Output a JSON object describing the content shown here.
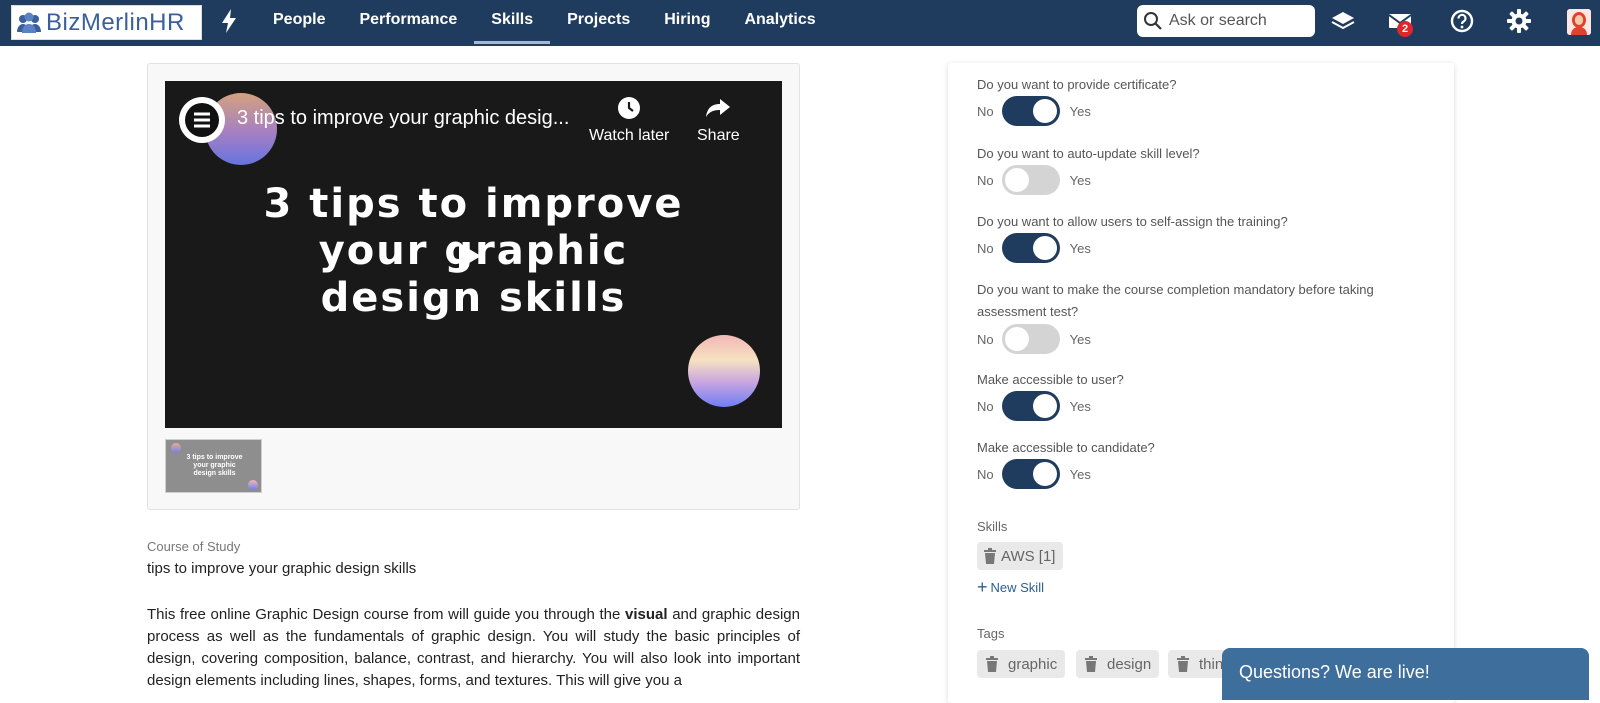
{
  "brand": {
    "name": "BizMerlinHR"
  },
  "nav": {
    "items": [
      {
        "label": "People"
      },
      {
        "label": "Performance"
      },
      {
        "label": "Skills",
        "active": true
      },
      {
        "label": "Projects"
      },
      {
        "label": "Hiring"
      },
      {
        "label": "Analytics"
      }
    ]
  },
  "search": {
    "placeholder": "Ask or search"
  },
  "notifications": {
    "mail_count": "2"
  },
  "colors": {
    "nav_bg": "#1f3c5e",
    "toggle_on": "#1f3c5e",
    "toggle_off": "#d4d4d4",
    "chat_bg": "#3d6e9c",
    "badge": "#e0262b"
  },
  "icons": [
    "bolt-icon",
    "search-icon",
    "layers-icon",
    "mail-icon",
    "help-icon",
    "gear-icon",
    "avatar",
    "play-icon",
    "clock-icon",
    "share-icon",
    "trash-icon",
    "plus-icon"
  ],
  "video": {
    "title": "3 tips to improve your graphic desig...",
    "watch_later": "Watch later",
    "share": "Share",
    "headline_line1": "3 tips to improve",
    "headline_line2": "your graphic",
    "headline_line3": "design skills",
    "thumb_line1": "3 tips to improve",
    "thumb_line2": "your graphic",
    "thumb_line3": "design skills"
  },
  "course": {
    "label": "Course of Study",
    "title": "tips to improve your graphic design skills",
    "desc_before": "This free online Graphic Design course from will guide you through the ",
    "desc_bold": "visual",
    "desc_after": " and graphic design process as well as the fundamentals of graphic design. You will study the basic principles of design, covering composition, balance, contrast, and hierarchy. You will also look into important design elements including lines, shapes, forms, and textures. This will give you a"
  },
  "settings": {
    "no": "No",
    "yes": "Yes",
    "questions": [
      {
        "text": "Do you want to provide certificate?",
        "on": true
      },
      {
        "text": "Do you want to auto-update skill level?",
        "on": false
      },
      {
        "text": "Do you want to allow users to self-assign the training?",
        "on": true
      },
      {
        "text": "Do you want to make the course completion mandatory before taking assessment test?",
        "on": false
      },
      {
        "text": "Make accessible to user?",
        "on": true
      },
      {
        "text": "Make accessible to candidate?",
        "on": true
      }
    ],
    "skills_label": "Skills",
    "skills": [
      {
        "label": "AWS [1]"
      }
    ],
    "new_skill": "New Skill",
    "tags_label": "Tags",
    "tags": [
      {
        "label": "graphic"
      },
      {
        "label": "design"
      },
      {
        "label": "thin"
      }
    ]
  },
  "chat": {
    "label": "Questions? We are live!"
  }
}
